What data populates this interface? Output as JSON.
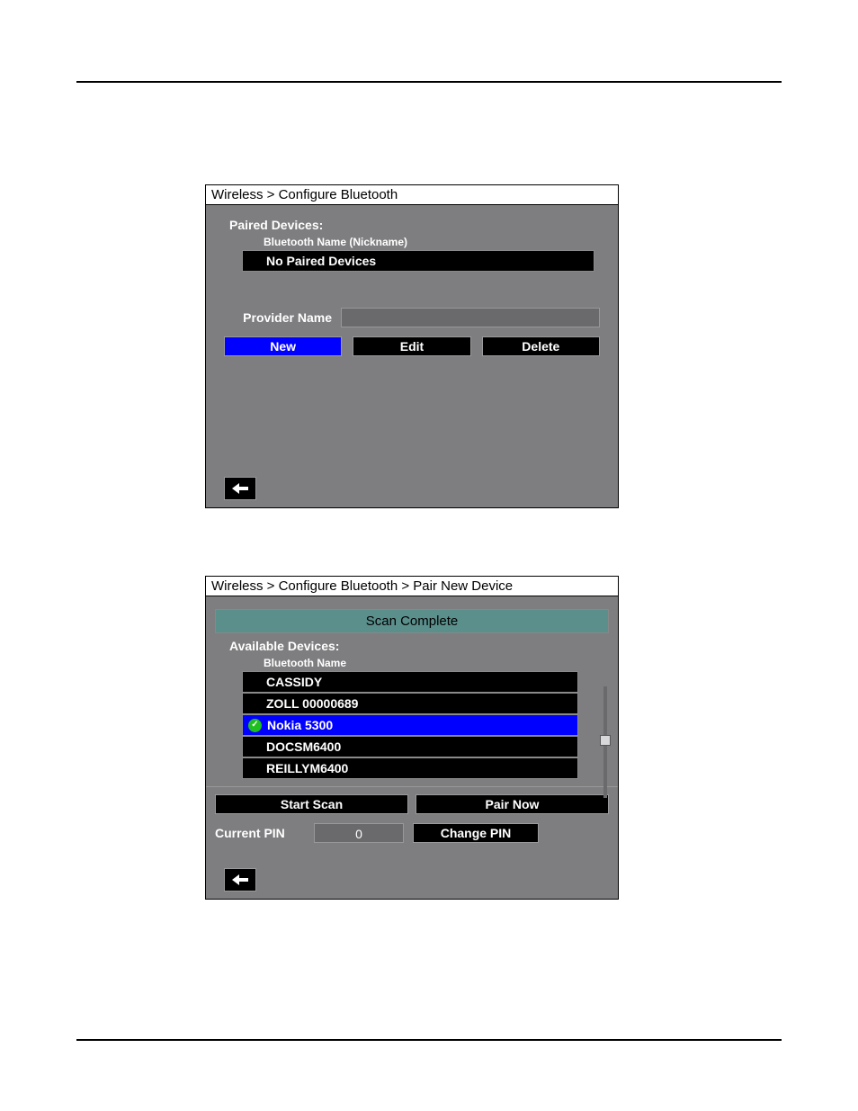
{
  "panel1": {
    "breadcrumb": "Wireless > Configure Bluetooth",
    "paired_devices_label": "Paired Devices:",
    "column_header": "Bluetooth Name (Nickname)",
    "empty_row": "No Paired Devices",
    "provider_name_label": "Provider Name",
    "provider_name_value": "",
    "buttons": {
      "new": "New",
      "edit": "Edit",
      "delete": "Delete"
    }
  },
  "panel2": {
    "breadcrumb": "Wireless > Configure Bluetooth > Pair New Device",
    "status": "Scan Complete",
    "available_devices_label": "Available Devices:",
    "column_header": "Bluetooth Name",
    "devices": [
      {
        "name": "CASSIDY",
        "selected": false
      },
      {
        "name": "ZOLL 00000689",
        "selected": false
      },
      {
        "name": "Nokia 5300",
        "selected": true
      },
      {
        "name": "DOCSM6400",
        "selected": false
      },
      {
        "name": "REILLYM6400",
        "selected": false
      }
    ],
    "buttons": {
      "start_scan": "Start Scan",
      "pair_now": "Pair Now",
      "change_pin": "Change PIN"
    },
    "current_pin_label": "Current PIN",
    "current_pin_value": "0"
  }
}
